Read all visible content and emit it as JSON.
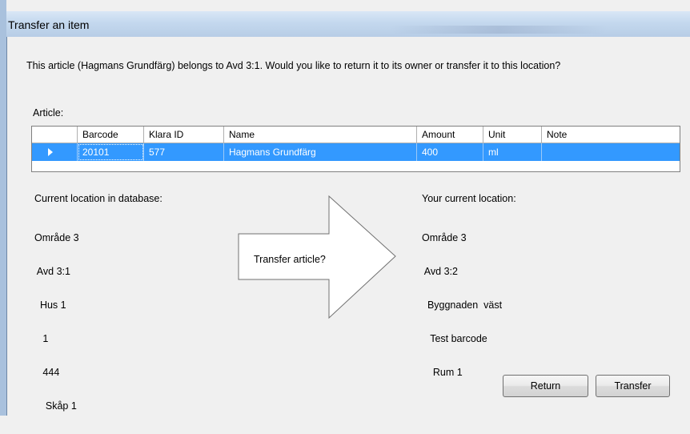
{
  "window": {
    "title": "Transfer an item"
  },
  "message": "This article (Hagmans Grundfärg) belongs to Avd 3:1. Would you like to return it to its owner or transfer it to this location?",
  "article_label": "Article:",
  "grid": {
    "headers": [
      "",
      "Barcode",
      "Klara ID",
      "Name",
      "Amount",
      "Unit",
      "Note"
    ],
    "rows": [
      {
        "barcode": "20101",
        "klara_id": "577",
        "name": "Hagmans Grundfärg",
        "amount": "400",
        "unit": "ml",
        "note": ""
      }
    ],
    "selected_color": "#3399ff"
  },
  "current_db": {
    "title": "Current location in database:",
    "lines": [
      "Område 3",
      " Avd 3:1",
      "  Hus 1",
      "   1",
      "   444",
      "    Skåp 1"
    ]
  },
  "arrow": {
    "label": "Transfer article?"
  },
  "your_location": {
    "title": "Your current location:",
    "lines": [
      "Område 3",
      " Avd 3:2",
      "  Byggnaden  väst",
      "   Test barcode",
      "    Rum 1"
    ]
  },
  "buttons": {
    "return": "Return",
    "transfer": "Transfer"
  }
}
